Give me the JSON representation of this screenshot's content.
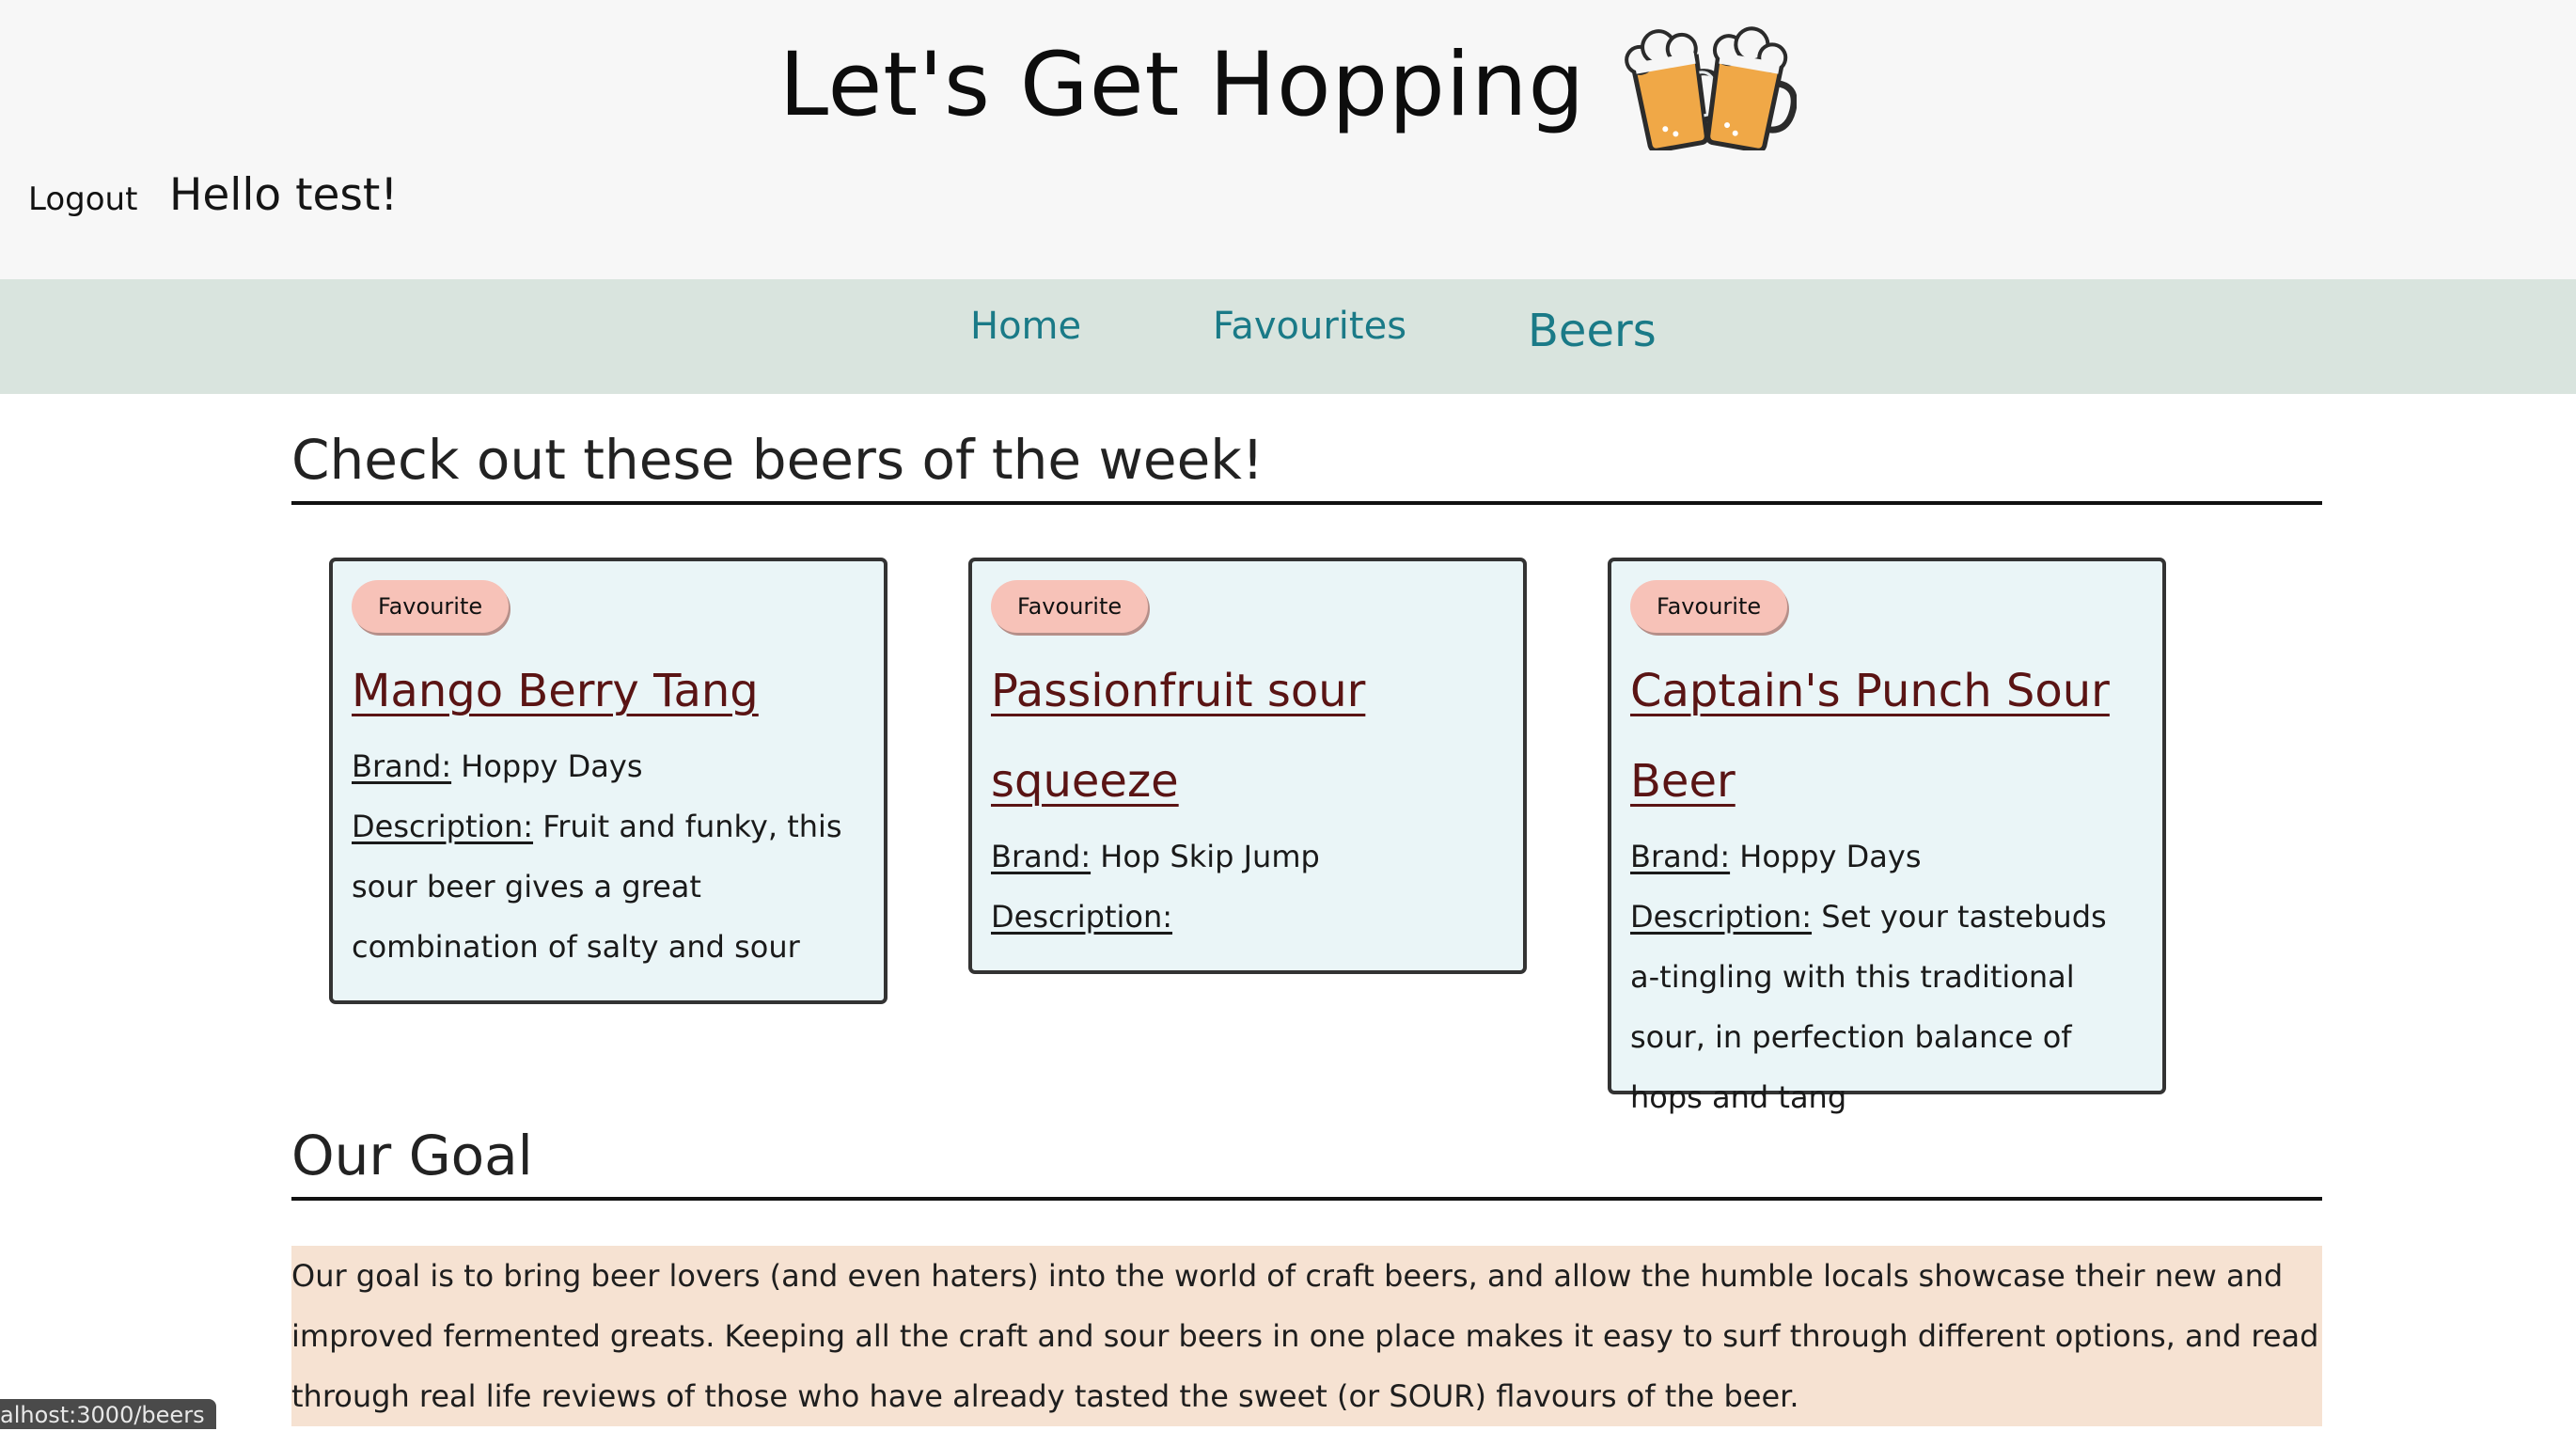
{
  "header": {
    "title": "Let's Get Hopping",
    "logout_label": "Logout",
    "greeting": "Hello test!",
    "logo_icon": "clinking-beer-mugs-icon"
  },
  "nav": {
    "items": [
      {
        "label": "Home"
      },
      {
        "label": "Favourites"
      },
      {
        "label": "Beers"
      }
    ],
    "color": "#1a7a87"
  },
  "beers_section": {
    "heading": "Check out these beers of the week!"
  },
  "beers": [
    {
      "favourite_label": "Favourite",
      "name": "Mango Berry Tang",
      "brand_label": "Brand:",
      "brand": "Hoppy Days",
      "description_label": "Description:",
      "description": "Fruit and funky, this sour beer gives a great combination of salty and sour"
    },
    {
      "favourite_label": "Favourite",
      "name": "Passionfruit sour squeeze",
      "brand_label": "Brand:",
      "brand": "Hop Skip Jump",
      "description_label": "Description:",
      "description": ""
    },
    {
      "favourite_label": "Favourite",
      "name": "Captain's Punch Sour Beer",
      "brand_label": "Brand:",
      "brand": "Hoppy Days",
      "description_label": "Description:",
      "description": "Set your tastebuds a-tingling with this traditional sour, in perfection balance of hops and tang"
    }
  ],
  "goal_section": {
    "heading": "Our Goal",
    "text": "Our goal is to bring beer lovers (and even haters) into the world of craft beers, and allow the humble locals showcase their new and improved fermented greats. Keeping all the craft and sour beers in one place makes it easy to surf through different options, and read through real life reviews of those who have already tasted the sweet (or SOUR) flavours of the beer."
  },
  "status_bar": {
    "url": "alhost:3000/beers"
  },
  "colors": {
    "header_bg": "#f7f7f7",
    "nav_bg": "#d9e4de",
    "card_bg": "#eaf5f7",
    "favourite_button": "#f7c2b8",
    "beer_name": "#5a1414",
    "goal_bg": "#f6e2d2"
  }
}
